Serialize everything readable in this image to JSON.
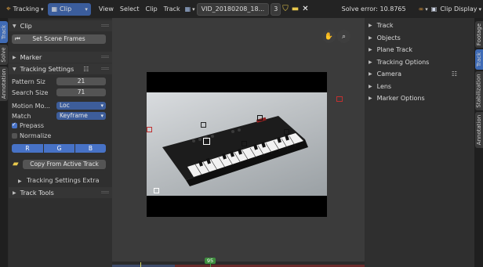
{
  "topbar": {
    "workspace": "Tracking",
    "mode": "Clip",
    "menus": [
      "View",
      "Select",
      "Clip",
      "Track"
    ],
    "filename": "VID_20180208_18...",
    "user_count": "3",
    "solve_error": "Solve error: 10.8765",
    "clip_display": "Clip Display"
  },
  "left_tabs": [
    "Track",
    "Solve",
    "Annotation"
  ],
  "left_panel": {
    "clip_header": "Clip",
    "set_scene_frames": "Set Scene Frames",
    "marker_header": "Marker",
    "tracking_settings_header": "Tracking Settings",
    "pattern_size_label": "Pattern Siz",
    "pattern_size_value": "21",
    "search_size_label": "Search Size",
    "search_size_value": "71",
    "motion_model_label": "Motion Mo...",
    "motion_model_value": "Loc",
    "match_label": "Match",
    "match_value": "Keyframe",
    "prepass_label": "Prepass",
    "prepass_checked": true,
    "normalize_label": "Normalize",
    "normalize_checked": false,
    "channels": [
      "R",
      "G",
      "B"
    ],
    "copy_from_active": "Copy From Active Track",
    "tracking_settings_extra": "Tracking Settings Extra",
    "track_tools_header": "Track Tools"
  },
  "right_panel": {
    "items": [
      "Track",
      "Objects",
      "Plane Track",
      "Tracking Options",
      "Camera",
      "Lens",
      "Marker Options"
    ]
  },
  "right_tabs": [
    "Footage",
    "Track",
    "Stabilization",
    "Annotation"
  ],
  "timeline": {
    "current_frame": "95"
  },
  "colors": {
    "accent": "#4772c6",
    "frame_badge": "#3e8e3e"
  }
}
